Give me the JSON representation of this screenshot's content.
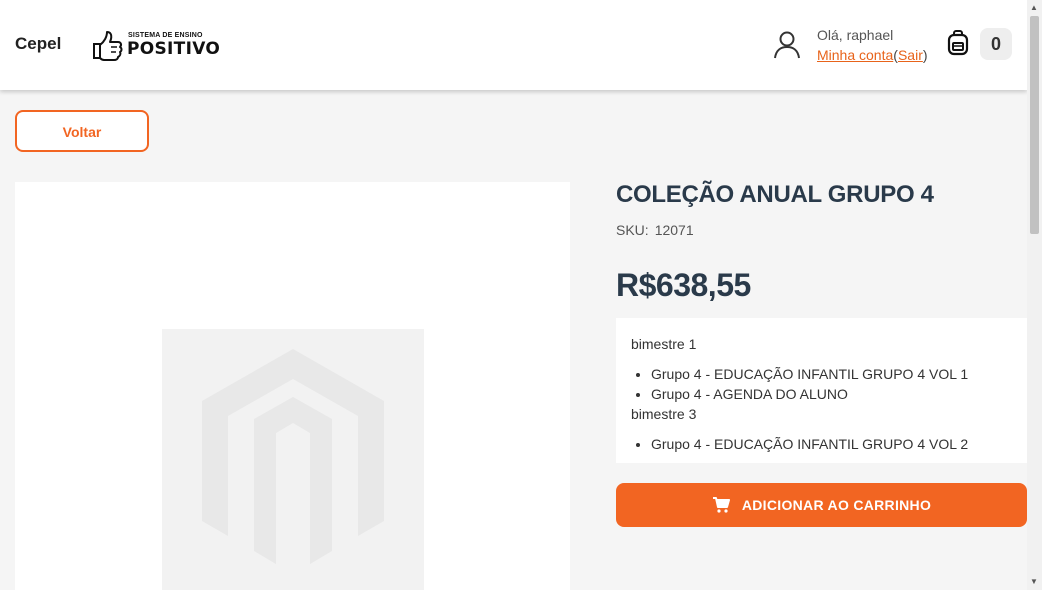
{
  "header": {
    "school_name": "Cepel",
    "logo": {
      "top_text": "SISTEMA DE ENSINO",
      "main_text": "POSITIVO"
    },
    "user": {
      "greeting": "Olá, raphael",
      "account_link": "Minha conta",
      "open_paren": "(",
      "logout_link": "Sair",
      "close_paren": ")"
    },
    "cart_count": "0"
  },
  "actions": {
    "back_label": "Voltar",
    "add_to_cart_label": "ADICIONAR AO CARRINHO"
  },
  "product": {
    "title": "COLEÇÃO ANUAL GRUPO 4",
    "sku_label": "SKU:",
    "sku_value": "12071",
    "price": "R$638,55",
    "description": {
      "groups": [
        {
          "title": "bimestre 1",
          "items": [
            "Grupo 4 - EDUCAÇÃO INFANTIL GRUPO 4 VOL 1",
            "Grupo 4 - AGENDA DO ALUNO"
          ]
        },
        {
          "title": "bimestre 3",
          "items": [
            "Grupo 4 - EDUCAÇÃO INFANTIL GRUPO 4 VOL 2"
          ]
        }
      ]
    }
  },
  "icons": {
    "user": "user-icon",
    "cart": "backpack-icon",
    "add_cart": "cart-icon",
    "logo": "thumbs-up-icon",
    "placeholder": "magento-logo-icon"
  },
  "colors": {
    "accent": "#f26522",
    "title": "#2a3a4a",
    "link": "#e8631a"
  }
}
